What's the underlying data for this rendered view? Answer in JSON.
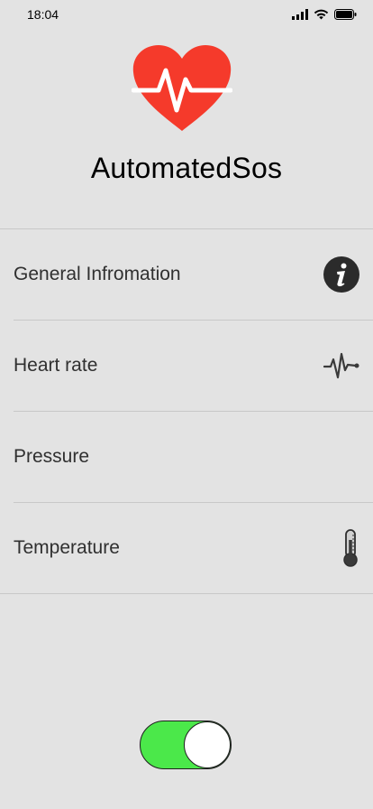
{
  "status_bar": {
    "time": "18:04",
    "icons": [
      "signal-icon",
      "wifi-icon",
      "battery-icon"
    ]
  },
  "app": {
    "logo": "heart-pulse-logo",
    "title": "AutomatedSos",
    "accent_color": "#f53a2b"
  },
  "menu": {
    "items": [
      {
        "label": "General Infromation",
        "icon": "info-icon"
      },
      {
        "label": "Heart rate",
        "icon": "heartbeat-icon"
      },
      {
        "label": "Pressure",
        "icon": ""
      },
      {
        "label": "Temperature",
        "icon": "thermometer-icon"
      }
    ]
  },
  "toggle": {
    "state": "on",
    "on_color": "#4be84a"
  }
}
